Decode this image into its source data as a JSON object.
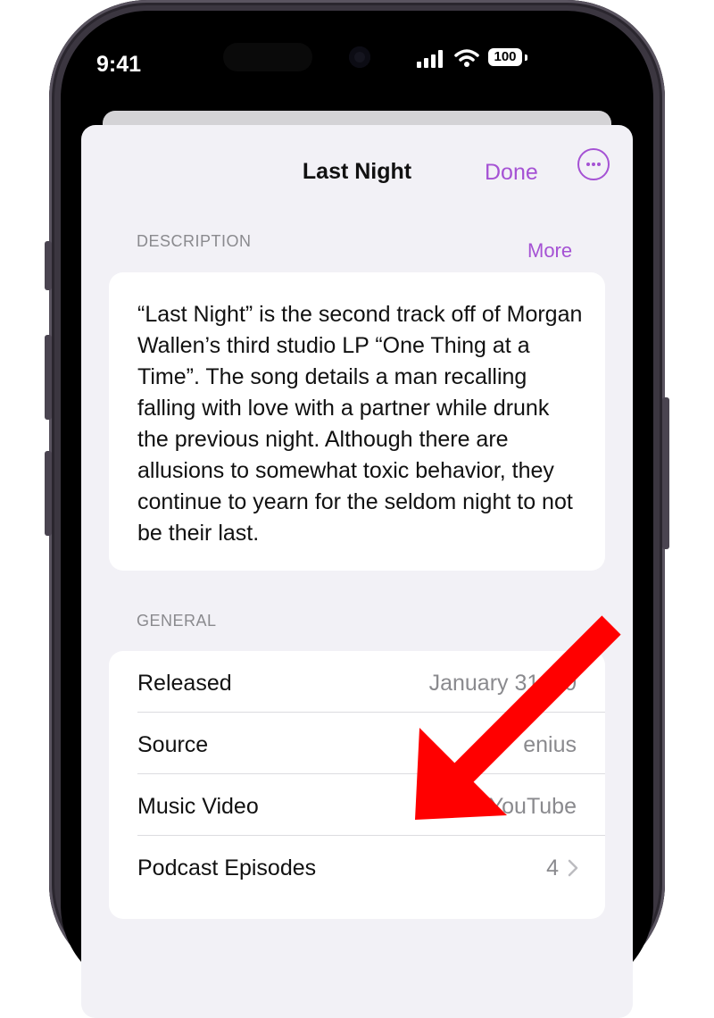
{
  "status_bar": {
    "time": "9:41",
    "battery": "100"
  },
  "sheet": {
    "title": "Last Night",
    "done_label": "Done",
    "more_icon": "ellipsis-circle-icon"
  },
  "description": {
    "header": "DESCRIPTION",
    "more_label": "More",
    "text": "“Last Night” is the second track off of Morgan Wallen’s third studio LP “One Thing at a Time”. The song details a man recalling falling with love with a partner while drunk the previous night. Although there are allusions to somewhat toxic behavior, they continue to yearn for the seldom night to not be their last."
  },
  "general": {
    "header": "GENERAL",
    "rows": [
      {
        "label": "Released",
        "value": "January 31, 20"
      },
      {
        "label": "Source",
        "value": "enius"
      },
      {
        "label": "Music Video",
        "value": "YouTube"
      },
      {
        "label": "Podcast Episodes",
        "value": "4"
      }
    ]
  },
  "colors": {
    "accent": "#a552d4",
    "annotation_arrow": "#ff0000"
  }
}
